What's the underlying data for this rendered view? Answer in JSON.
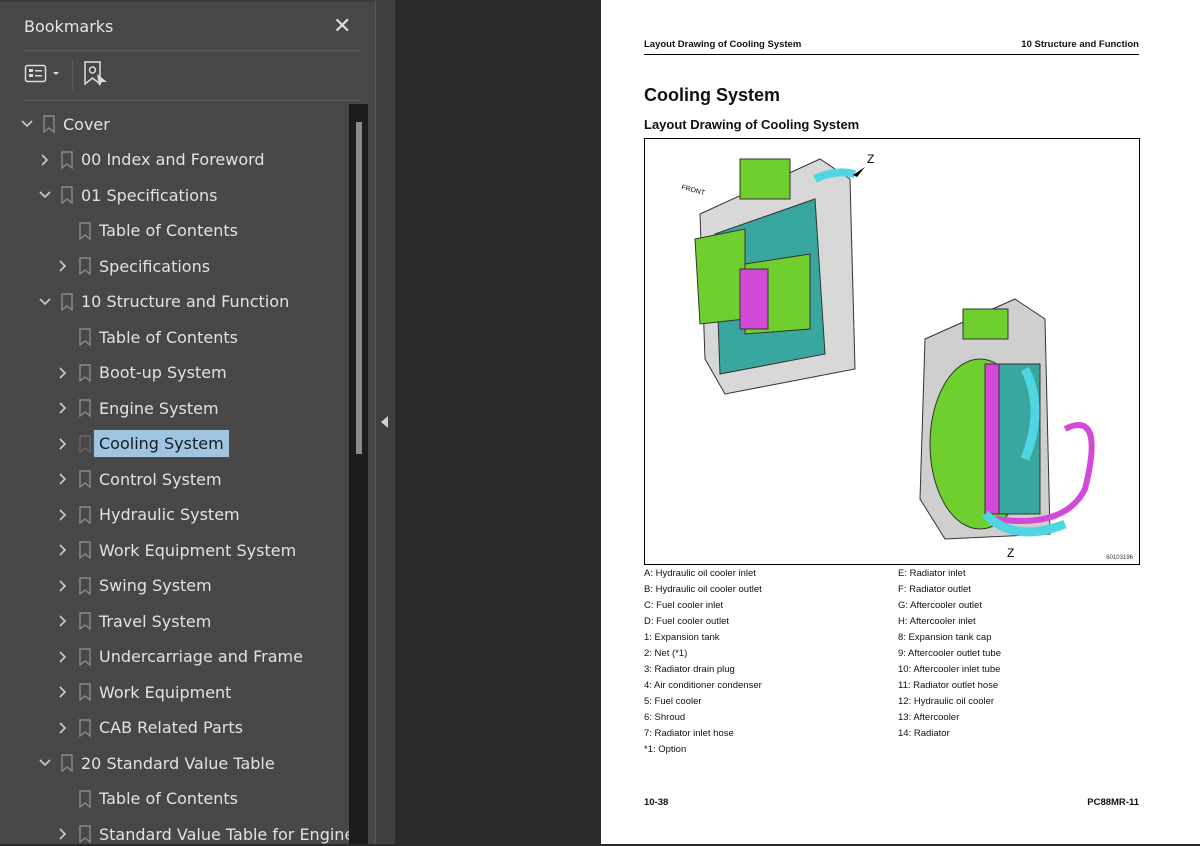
{
  "panel": {
    "title": "Bookmarks",
    "close_icon": "close-icon",
    "options_icon": "list-options-icon",
    "find_icon": "find-current-bookmark-icon"
  },
  "tree": [
    {
      "label": "Cover",
      "level": 0,
      "state": "expanded"
    },
    {
      "label": "00 Index and Foreword",
      "level": 1,
      "state": "collapsed"
    },
    {
      "label": "01 Specifications",
      "level": 1,
      "state": "expanded"
    },
    {
      "label": "Table of Contents",
      "level": 2,
      "state": "leaf"
    },
    {
      "label": "Specifications",
      "level": 2,
      "state": "collapsed"
    },
    {
      "label": "10 Structure and Function",
      "level": 1,
      "state": "expanded"
    },
    {
      "label": "Table of Contents",
      "level": 2,
      "state": "leaf"
    },
    {
      "label": "Boot-up System",
      "level": 2,
      "state": "collapsed"
    },
    {
      "label": "Engine System",
      "level": 2,
      "state": "collapsed"
    },
    {
      "label": "Cooling System",
      "level": 2,
      "state": "collapsed",
      "selected": true
    },
    {
      "label": "Control System",
      "level": 2,
      "state": "collapsed"
    },
    {
      "label": "Hydraulic System",
      "level": 2,
      "state": "collapsed"
    },
    {
      "label": "Work Equipment System",
      "level": 2,
      "state": "collapsed"
    },
    {
      "label": "Swing System",
      "level": 2,
      "state": "collapsed"
    },
    {
      "label": "Travel System",
      "level": 2,
      "state": "collapsed"
    },
    {
      "label": "Undercarriage and Frame",
      "level": 2,
      "state": "collapsed"
    },
    {
      "label": "Work Equipment",
      "level": 2,
      "state": "collapsed"
    },
    {
      "label": "CAB Related Parts",
      "level": 2,
      "state": "collapsed"
    },
    {
      "label": "20 Standard Value Table",
      "level": 1,
      "state": "expanded"
    },
    {
      "label": "Table of Contents",
      "level": 2,
      "state": "leaf"
    },
    {
      "label": "Standard Value Table for Engine",
      "level": 2,
      "state": "collapsed"
    }
  ],
  "colors": {
    "selection": "#9ec6e2",
    "green": "#6fcf2f",
    "teal": "#3aa6a0",
    "magenta": "#d24ad8",
    "cyan": "#4fd6e0"
  },
  "page": {
    "header_left": "Layout Drawing of Cooling System",
    "header_right": "10 Structure and Function",
    "title": "Cooling System",
    "subtitle": "Layout Drawing of Cooling System",
    "figure_id": "60103196",
    "figure_labels": {
      "front": "FRONT",
      "z": "Z"
    },
    "legend_left": [
      "A: Hydraulic oil cooler inlet",
      "B: Hydraulic oil cooler outlet",
      "C: Fuel cooler inlet",
      "D: Fuel cooler outlet",
      "1: Expansion tank",
      "2: Net (*1)",
      "3: Radiator drain plug",
      "4: Air conditioner condenser",
      "5: Fuel cooler",
      "6: Shroud",
      "7: Radiator inlet hose",
      "*1: Option"
    ],
    "legend_right": [
      "E: Radiator inlet",
      "F: Radiator outlet",
      "G: Aftercooler outlet",
      "H: Aftercooler inlet",
      "8: Expansion tank cap",
      "9: Aftercooler outlet tube",
      "10: Aftercooler inlet tube",
      "11: Radiator outlet hose",
      "12: Hydraulic oil cooler",
      "13: Aftercooler",
      "14: Radiator"
    ],
    "footer_left": "10-38",
    "footer_right": "PC88MR-11"
  }
}
